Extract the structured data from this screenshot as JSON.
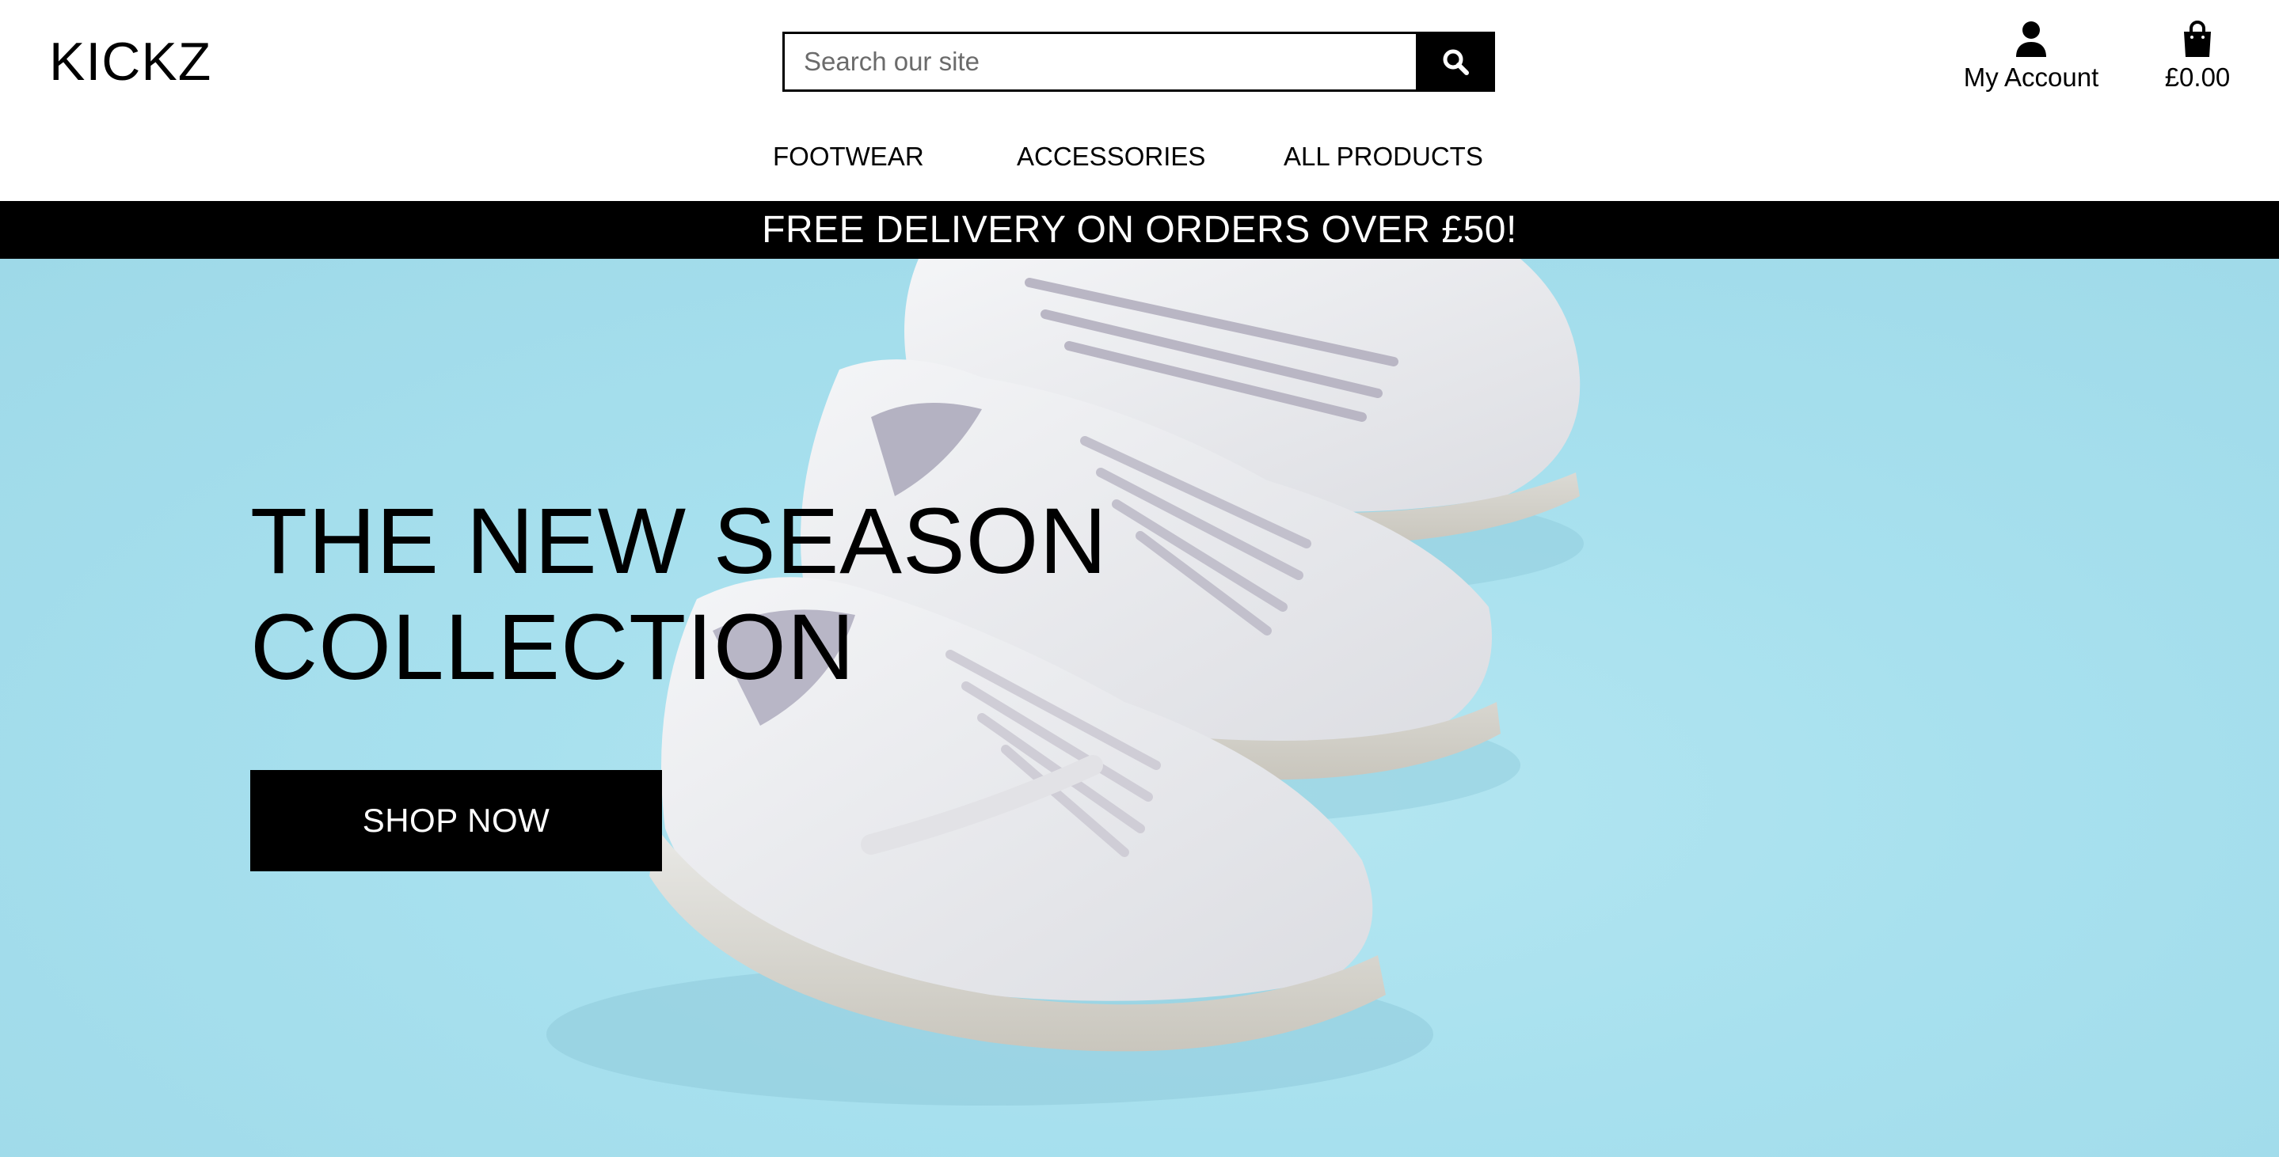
{
  "brand": {
    "logo": "KICKZ"
  },
  "search": {
    "placeholder": "Search our site",
    "icon": "search-icon"
  },
  "account": {
    "label": "My Account",
    "icon": "user-icon"
  },
  "bag": {
    "total": "£0.00",
    "icon": "shopping-bag-icon"
  },
  "nav": {
    "items": [
      {
        "label": "FOOTWEAR"
      },
      {
        "label": "ACCESSORIES"
      },
      {
        "label": "ALL PRODUCTS"
      }
    ]
  },
  "banner": {
    "text": "FREE DELIVERY ON ORDERS OVER £50!"
  },
  "hero": {
    "title_line1": "THE NEW SEASON",
    "title_line2": "COLLECTION",
    "cta_label": "SHOP NOW",
    "background_color": "#a7e0ee"
  },
  "colors": {
    "accent": "#000000",
    "text_on_dark": "#ffffff"
  }
}
